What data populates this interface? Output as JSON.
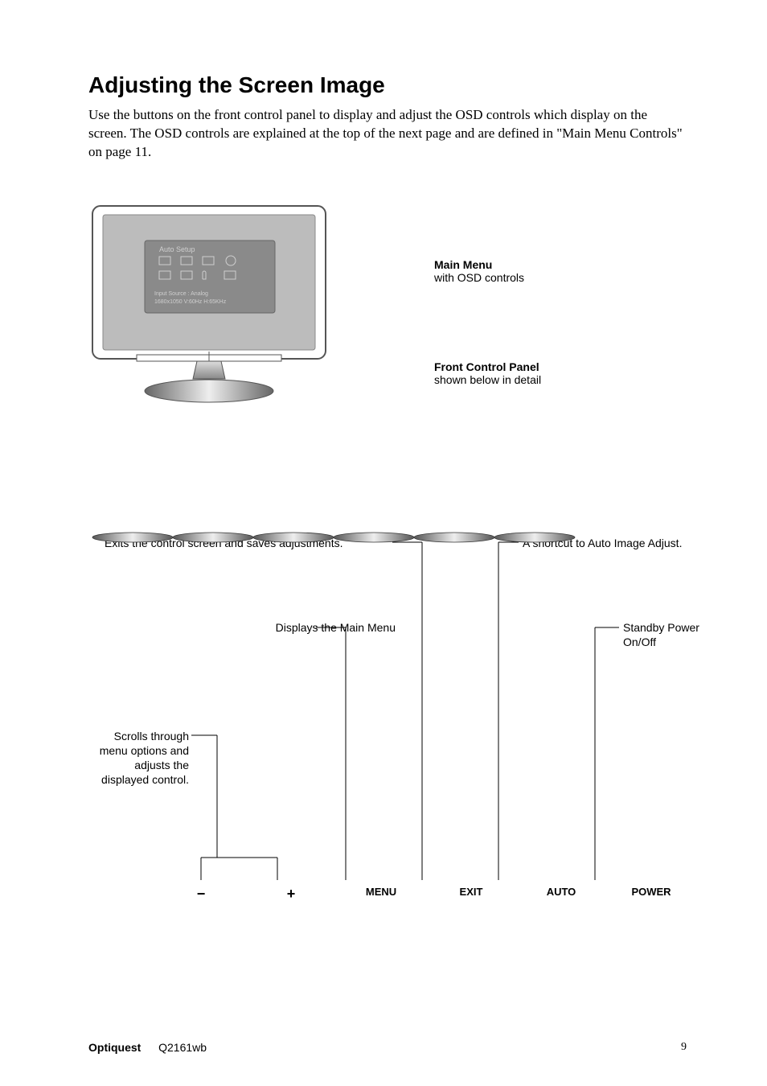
{
  "heading": "Adjusting the Screen Image",
  "intro": "Use the buttons on the front control panel to display and adjust the OSD controls which display on the screen. The OSD controls are explained at the top of the next page and are defined in \"Main Menu Controls\" on page 11.",
  "osd": {
    "title": "Auto Setup",
    "line1": "Input Source     :     Analog",
    "line2": "1680x1050  V:60Hz      H:65KHz"
  },
  "main_menu": {
    "title": "Main Menu",
    "sub": "with OSD controls"
  },
  "fcp": {
    "title": "Front Control Panel",
    "sub": "shown below in detail"
  },
  "labels": {
    "exit": "Exits the control screen and saves adjustments.",
    "auto": "A shortcut to Auto Image Adjust.",
    "menu": "Displays the Main Menu",
    "power": "Standby Power On/Off",
    "scroll": "Scrolls through menu options and adjusts the displayed control."
  },
  "buttons": {
    "minus": "−",
    "plus": "+",
    "menu": "MENU",
    "exit": "EXIT",
    "auto": "AUTO",
    "power": "POWER"
  },
  "footer": {
    "brand": "Optiquest",
    "model": "Q2161wb",
    "page": "9"
  }
}
